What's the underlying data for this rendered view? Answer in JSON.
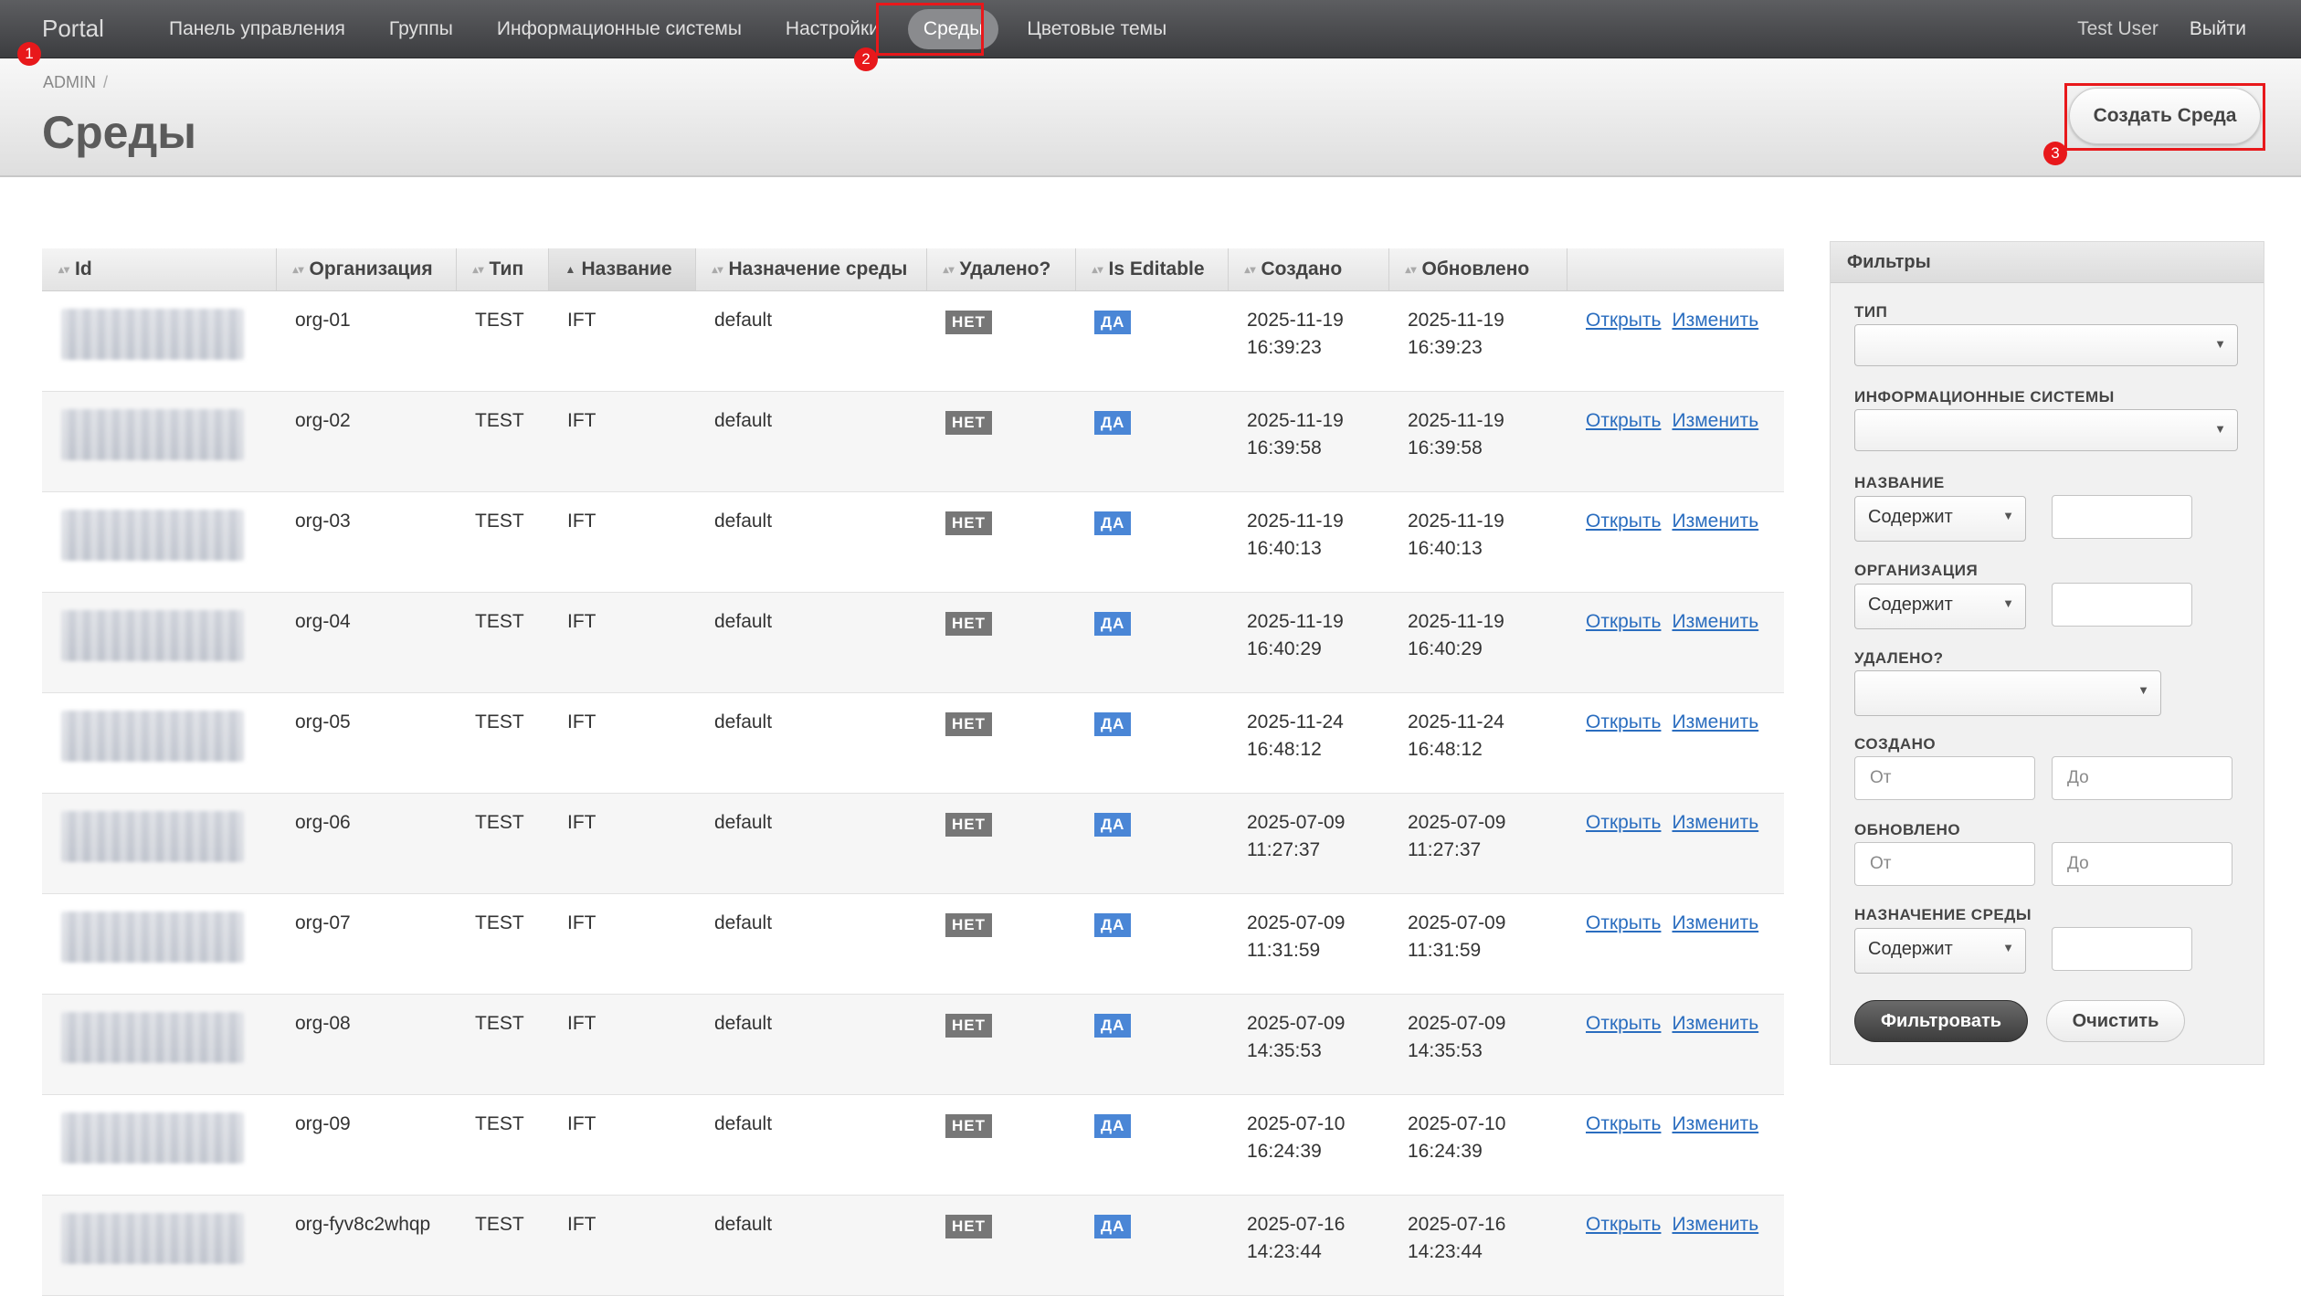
{
  "navbar": {
    "brand": "Portal",
    "items": [
      {
        "label": "Панель управления"
      },
      {
        "label": "Группы"
      },
      {
        "label": "Информационные системы"
      },
      {
        "label": "Настройки"
      },
      {
        "label": "Среды"
      },
      {
        "label": "Цветовые темы"
      }
    ],
    "user": "Test User",
    "logout": "Выйти"
  },
  "header": {
    "breadcrumb": "ADMIN",
    "breadcrumb_sep": "/",
    "title": "Среды",
    "create_button": "Создать Среда"
  },
  "markers": [
    "1",
    "2",
    "3"
  ],
  "table": {
    "columns": [
      "Id",
      "Организация",
      "Тип",
      "Название",
      "Назначение среды",
      "Удалено?",
      "Is Editable",
      "Создано",
      "Обновлено",
      ""
    ],
    "open_label": "Открыть",
    "edit_label": "Изменить",
    "rows": [
      {
        "org": "org-01",
        "type": "TEST",
        "name": "IFT",
        "purpose": "default",
        "deleted": "НЕТ",
        "editable": "ДА",
        "created_date": "2025-11-19",
        "created_time": "16:39:23",
        "updated_date": "2025-11-19",
        "updated_time": "16:39:23"
      },
      {
        "org": "org-02",
        "type": "TEST",
        "name": "IFT",
        "purpose": "default",
        "deleted": "НЕТ",
        "editable": "ДА",
        "created_date": "2025-11-19",
        "created_time": "16:39:58",
        "updated_date": "2025-11-19",
        "updated_time": "16:39:58"
      },
      {
        "org": "org-03",
        "type": "TEST",
        "name": "IFT",
        "purpose": "default",
        "deleted": "НЕТ",
        "editable": "ДА",
        "created_date": "2025-11-19",
        "created_time": "16:40:13",
        "updated_date": "2025-11-19",
        "updated_time": "16:40:13"
      },
      {
        "org": "org-04",
        "type": "TEST",
        "name": "IFT",
        "purpose": "default",
        "deleted": "НЕТ",
        "editable": "ДА",
        "created_date": "2025-11-19",
        "created_time": "16:40:29",
        "updated_date": "2025-11-19",
        "updated_time": "16:40:29"
      },
      {
        "org": "org-05",
        "type": "TEST",
        "name": "IFT",
        "purpose": "default",
        "deleted": "НЕТ",
        "editable": "ДА",
        "created_date": "2025-11-24",
        "created_time": "16:48:12",
        "updated_date": "2025-11-24",
        "updated_time": "16:48:12"
      },
      {
        "org": "org-06",
        "type": "TEST",
        "name": "IFT",
        "purpose": "default",
        "deleted": "НЕТ",
        "editable": "ДА",
        "created_date": "2025-07-09",
        "created_time": "11:27:37",
        "updated_date": "2025-07-09",
        "updated_time": "11:27:37"
      },
      {
        "org": "org-07",
        "type": "TEST",
        "name": "IFT",
        "purpose": "default",
        "deleted": "НЕТ",
        "editable": "ДА",
        "created_date": "2025-07-09",
        "created_time": "11:31:59",
        "updated_date": "2025-07-09",
        "updated_time": "11:31:59"
      },
      {
        "org": "org-08",
        "type": "TEST",
        "name": "IFT",
        "purpose": "default",
        "deleted": "НЕТ",
        "editable": "ДА",
        "created_date": "2025-07-09",
        "created_time": "14:35:53",
        "updated_date": "2025-07-09",
        "updated_time": "14:35:53"
      },
      {
        "org": "org-09",
        "type": "TEST",
        "name": "IFT",
        "purpose": "default",
        "deleted": "НЕТ",
        "editable": "ДА",
        "created_date": "2025-07-10",
        "created_time": "16:24:39",
        "updated_date": "2025-07-10",
        "updated_time": "16:24:39"
      },
      {
        "org": "org-fyv8c2whqp",
        "type": "TEST",
        "name": "IFT",
        "purpose": "default",
        "deleted": "НЕТ",
        "editable": "ДА",
        "created_date": "2025-07-16",
        "created_time": "14:23:44",
        "updated_date": "2025-07-16",
        "updated_time": "14:23:44"
      }
    ]
  },
  "filters": {
    "title": "Фильтры",
    "type_label": "ТИП",
    "type_value": "",
    "systems_label": "ИНФОРМАЦИОННЫЕ СИСТЕМЫ",
    "systems_value": "",
    "name_label": "НАЗВАНИЕ",
    "name_operator": "Содержит",
    "name_value": "",
    "org_label": "ОРГАНИЗАЦИЯ",
    "org_operator": "Содержит",
    "org_value": "",
    "deleted_label": "УДАЛЕНО?",
    "deleted_value": "",
    "created_label": "СОЗДАНО",
    "created_from_placeholder": "От",
    "created_to_placeholder": "До",
    "updated_label": "ОБНОВЛЕНО",
    "updated_from_placeholder": "От",
    "updated_to_placeholder": "До",
    "purpose_label": "НАЗНАЧЕНИЕ СРЕДЫ",
    "purpose_operator": "Содержит",
    "purpose_value": "",
    "filter_button": "Фильтровать",
    "clear_button": "Очистить"
  },
  "colors": {
    "accent_blue": "#4a86d6",
    "badge_gray": "#777777",
    "marker_red": "#e8181b",
    "link": "#2a6dbf"
  }
}
